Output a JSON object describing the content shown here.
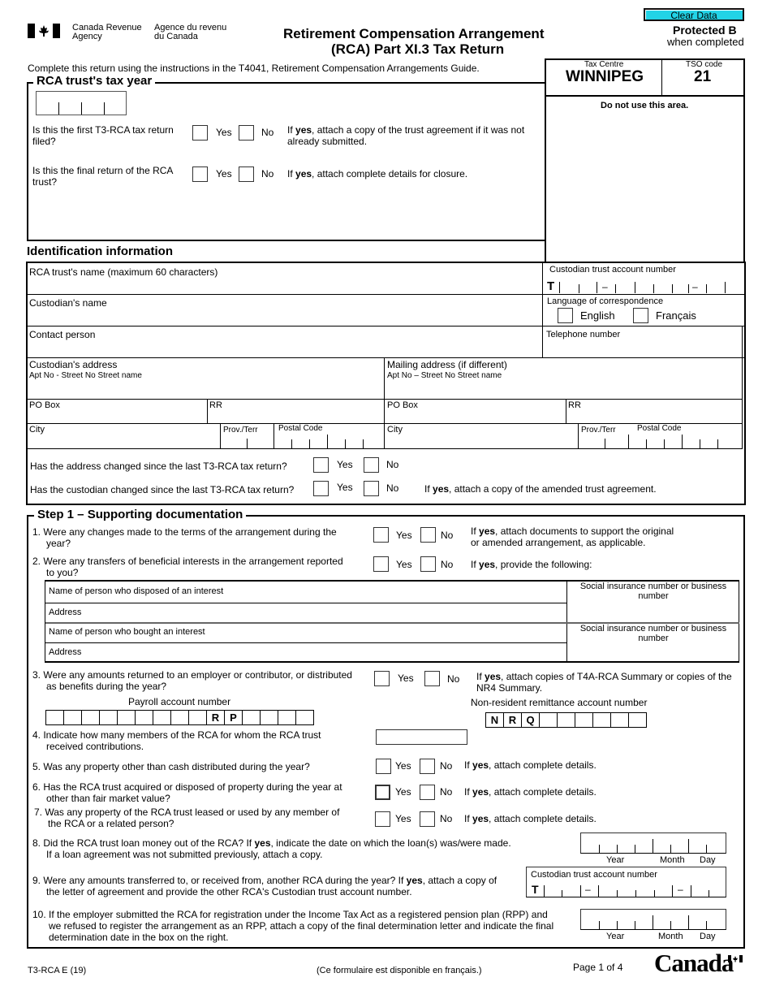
{
  "header": {
    "agency_en_1": "Canada Revenue",
    "agency_en_2": "Agency",
    "agency_fr_1": "Agence du revenu",
    "agency_fr_2": "du Canada",
    "title_1": "Retirement Compensation Arrangement",
    "title_2": "(RCA) Part XI.3 Tax Return",
    "clear_data_label": "Clear Data",
    "protected": "Protected B",
    "protected_sub": "when completed",
    "instructions": "Complete this return using the instructions in the T4041, Retirement Compensation Arrangements Guide."
  },
  "office": {
    "tax_centre_label": "Tax Centre",
    "tax_centre_value": "WINNIPEG",
    "tso_label": "TSO code",
    "tso_value": "21",
    "do_not_use": "Do not use this area."
  },
  "tax_year": {
    "title": "RCA trust's tax year",
    "first_return_q": "Is this the first T3-RCA tax return filed?",
    "first_return_note_pre": "If ",
    "first_return_note_bold": "yes",
    "first_return_note_post": ", attach a copy of the trust agreement if it was not already submitted.",
    "final_return_q": "Is this the final return of the RCA trust?",
    "final_return_note_pre": "If ",
    "final_return_note_bold": "yes",
    "final_return_note_post": ", attach complete details for closure.",
    "yes": "Yes",
    "no": "No"
  },
  "identification": {
    "title": "Identification information",
    "trust_name_label": "RCA trust's name (maximum 60 characters)",
    "custodian_name_label": "Custodian's name",
    "contact_person_label": "Contact person",
    "custodian_account_label": "Custodian trust account number",
    "account_prefix": "T",
    "dash": "–",
    "language_label": "Language of correspondence",
    "english": "English",
    "francais": "Français",
    "telephone_label": "Telephone number",
    "custodian_address_label": "Custodian's address",
    "custodian_address_sub": "Apt No - Street No  Street name",
    "mailing_address_label": "Mailing address (if different)",
    "mailing_address_sub": "Apt No – Street No  Street name",
    "po_box": "PO Box",
    "rr": "RR",
    "city": "City",
    "prov_terr": "Prov./Terr",
    "postal_code": "Postal Code",
    "address_changed_q": "Has the address changed since the last T3-RCA tax return?",
    "custodian_changed_q": "Has the custodian changed since the last T3-RCA tax return?",
    "custodian_changed_note_pre": "If ",
    "custodian_changed_note_bold": "yes",
    "custodian_changed_note_post": ", attach a copy of the amended trust agreement.",
    "yes": "Yes",
    "no": "No"
  },
  "step1": {
    "title": "Step 1 – Supporting documentation",
    "yes": "Yes",
    "no": "No",
    "if": "If ",
    "yes_bold": "yes",
    "q1": "1.  Were any changes made to the terms of the arrangement during the",
    "q1b": "year?",
    "q1_note_post": ", attach documents to support the original",
    "q1_note_2": "or amended arrangement, as applicable.",
    "q2": "2.  Were any transfers of beneficial interests in the arrangement reported",
    "q2b": "to you?",
    "q2_note_post": ", provide the following:",
    "disposed_name": "Name of person who disposed of an interest",
    "address": "Address",
    "bought_name": "Name of person who bought an interest",
    "sin_bn": "Social insurance number or business number",
    "q3": "3.  Were any amounts returned to an employer or contributor, or distributed",
    "q3b": "as benefits during the year?",
    "q3_note_post": ", attach copies of T4A-RCA Summary or copies of the",
    "q3_note_2": "NR4 Summary.",
    "payroll_label": "Payroll account number",
    "payroll_rp": [
      "R",
      "P"
    ],
    "nr_label": "Non-resident remittance account number",
    "nr_prefix": [
      "N",
      "R",
      "Q"
    ],
    "q4": "4.  Indicate how many members of the RCA for whom the RCA trust",
    "q4b": "received contributions.",
    "q5": "5.  Was any property other than cash distributed during the year?",
    "q6": "6.  Has the RCA trust acquired or disposed of property during the year at",
    "q6b": "other than fair market value?",
    "q7": "7.  Was any property of the RCA trust leased or used by any member of",
    "q7b": "the RCA or a related person?",
    "details_note_post": ", attach complete details.",
    "q8_pre": "8.  Did the RCA trust loan money out of the RCA? If ",
    "q8_post": ", indicate the date on which the loan(s) was/were made.",
    "q8b": "If a loan agreement was not submitted previously, attach a copy.",
    "q9_pre": "9.  Were any amounts transferred to, or received from, another RCA during the year? If ",
    "q9_post": ", attach a copy of",
    "q9b": "the letter of agreement and provide the other RCA's Custodian trust account number.",
    "q10": "10. If the employer submitted the RCA for registration under the Income Tax Act as a registered pension plan (RPP) and",
    "q10b": "we refused to register the arrangement as an RPP, attach a copy of the final determination letter and indicate the final",
    "q10c": "determination date in the box on the right.",
    "custodian_account_label": "Custodian trust account number",
    "account_prefix": "T",
    "dash": "–",
    "year": "Year",
    "month": "Month",
    "day": "Day"
  },
  "footer": {
    "form_code": "T3-RCA E (19)",
    "french_note": "(Ce formulaire est disponible en français.)",
    "page": "Page 1 of 4",
    "wordmark": "Canada"
  }
}
